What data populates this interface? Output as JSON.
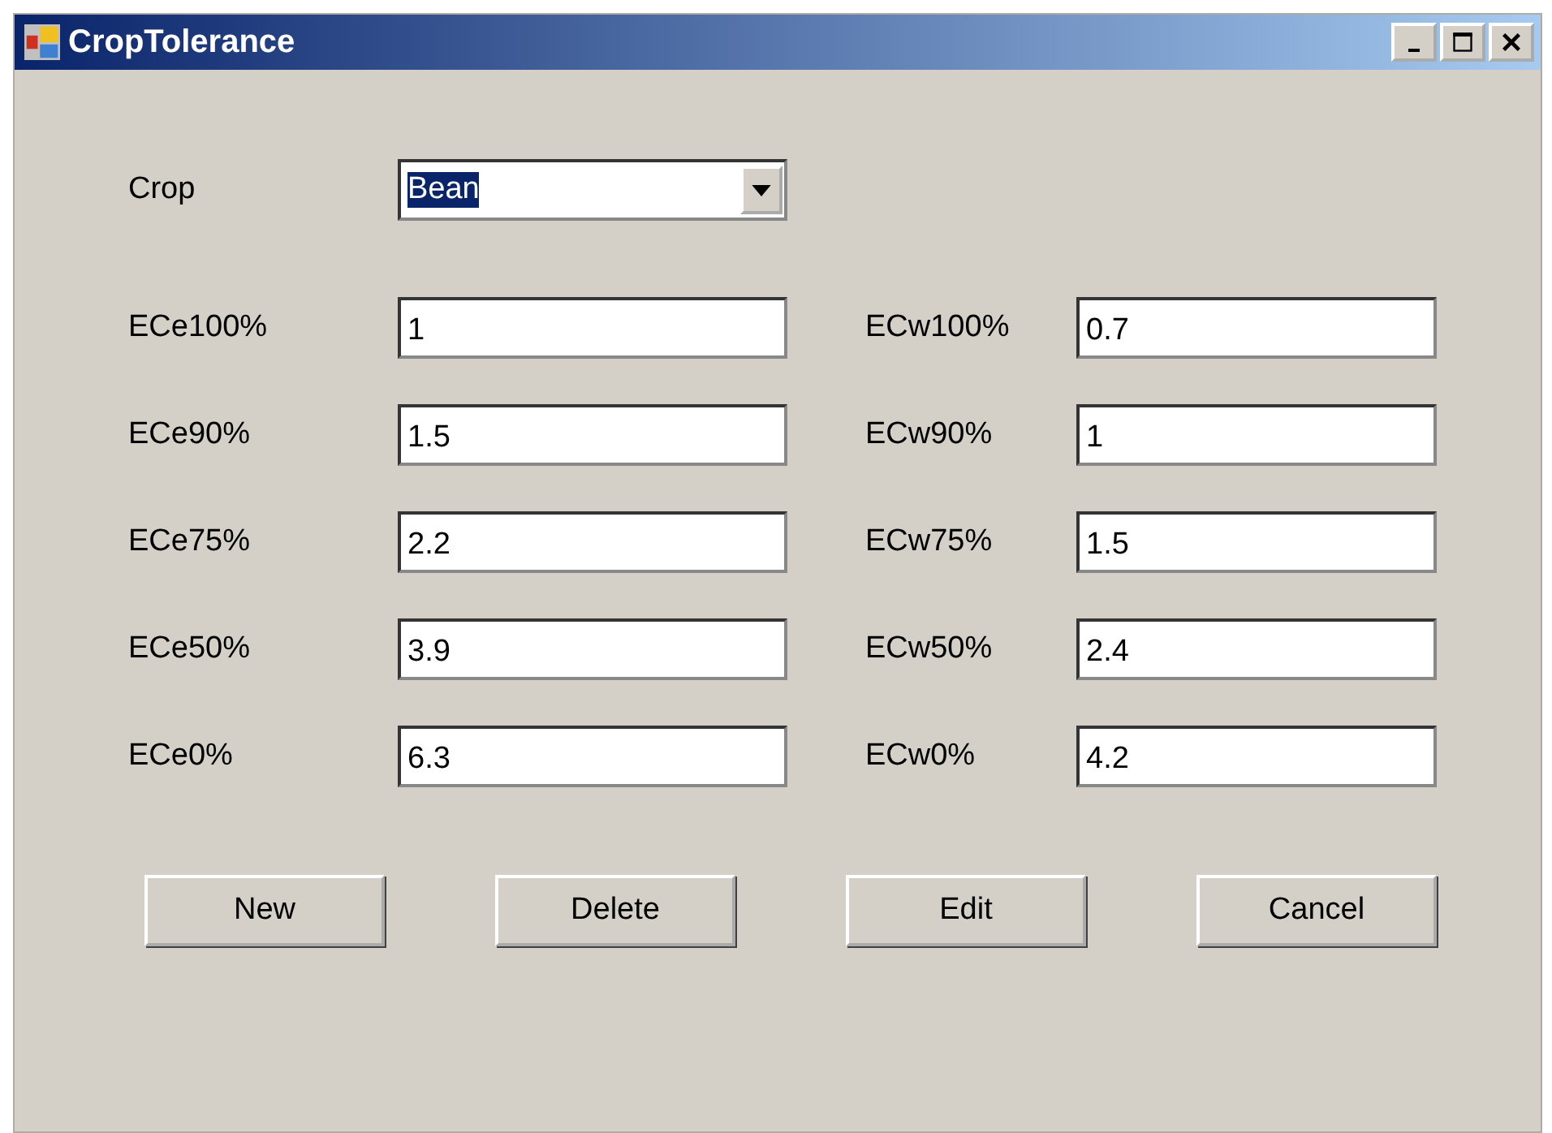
{
  "window": {
    "title": "CropTolerance"
  },
  "crop": {
    "label": "Crop",
    "value": "Bean",
    "text_selected": true
  },
  "left_fields": [
    {
      "label": "ECe100%",
      "value": "1"
    },
    {
      "label": "ECe90%",
      "value": "1.5"
    },
    {
      "label": "ECe75%",
      "value": "2.2"
    },
    {
      "label": "ECe50%",
      "value": "3.9"
    },
    {
      "label": "ECe0%",
      "value": "6.3"
    }
  ],
  "right_fields": [
    {
      "label": "ECw100%",
      "value": "0.7"
    },
    {
      "label": "ECw90%",
      "value": "1"
    },
    {
      "label": "ECw75%",
      "value": "1.5"
    },
    {
      "label": "ECw50%",
      "value": "2.4"
    },
    {
      "label": "ECw0%",
      "value": "4.2"
    }
  ],
  "buttons": [
    "New",
    "Delete",
    "Edit",
    "Cancel"
  ]
}
